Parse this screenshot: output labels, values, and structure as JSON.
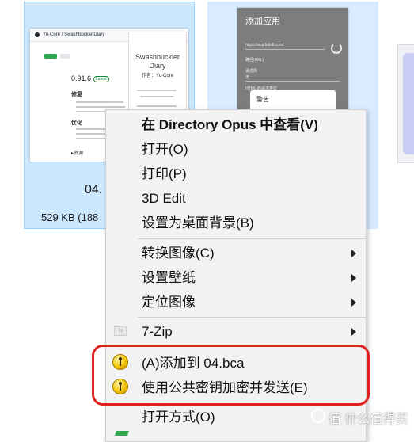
{
  "tiles": [
    {
      "name": "04.",
      "size": "529 KB (188",
      "thumb": {
        "repo": "Yu-Core / SwashbucklerDiary",
        "version": "0.91.6",
        "badge": "Latest",
        "section_fixes": "修复",
        "section_opt": "优化",
        "assets": "▸资源",
        "app_title": "Swashbuckler Diary",
        "app_author": "作者：Yu-Core"
      }
    },
    {
      "thumb": {
        "title": "添加应用",
        "url": "https://app.bitbili.com/",
        "field1": "路径(URL)",
        "field2": "请选择",
        "field2_value": "无",
        "html_label": "HTML 的请求类型",
        "dialog_title": "警告"
      }
    }
  ],
  "menu": {
    "items": [
      {
        "label": "在 Directory Opus 中查看(V)"
      },
      {
        "label": "打开(O)"
      },
      {
        "label": "打印(P)"
      },
      {
        "label": "3D Edit"
      },
      {
        "label": "设置为桌面背景(B)"
      },
      {
        "label": "转换图像(C)"
      },
      {
        "label": "设置壁纸"
      },
      {
        "label": "定位图像"
      },
      {
        "label": "7-Zip"
      },
      {
        "label": "(A)添加到 04.bca"
      },
      {
        "label": "使用公共密钥加密并发送(E)"
      },
      {
        "label": "打开方式(O)"
      }
    ],
    "zip_icon_text": "7z"
  },
  "watermark": {
    "text": "值 什么值得买"
  },
  "colors": {
    "highlight": "#e0201f",
    "tile_selected": "#cce8ff",
    "menu_bg": "#f2f2f2"
  }
}
